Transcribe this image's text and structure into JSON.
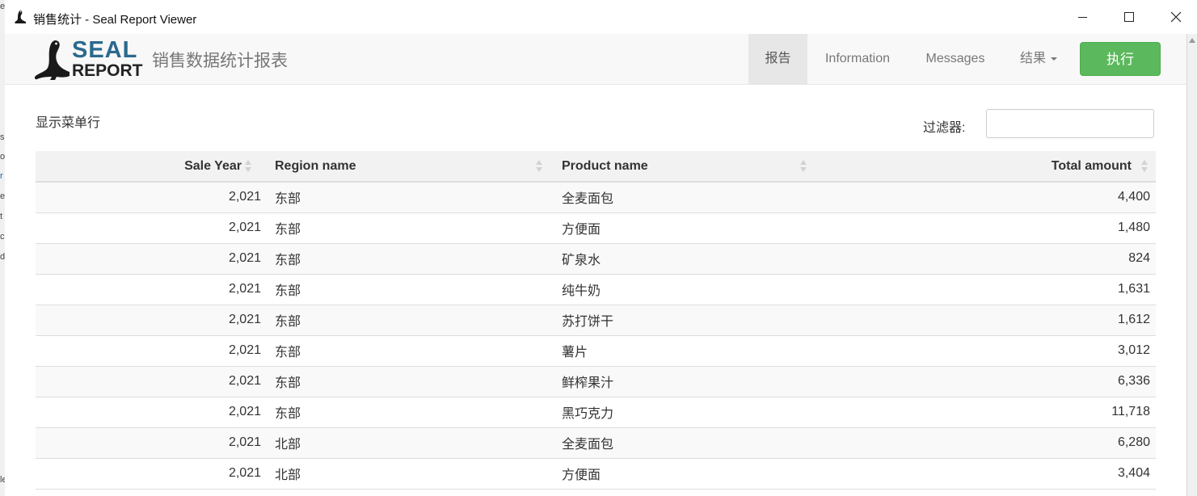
{
  "window": {
    "title": "销售统计 - Seal Report Viewer"
  },
  "desktop": {
    "left_fragments": [
      "e",
      "si",
      "o",
      "r",
      "e\t",
      "t",
      "c",
      "d",
      "le"
    ]
  },
  "navbar": {
    "logo_top": "SEAL",
    "logo_bottom": "REPORT",
    "brand_title": "销售数据统计报表",
    "items": [
      {
        "label": "报告",
        "active": true
      },
      {
        "label": "Information",
        "active": false
      },
      {
        "label": "Messages",
        "active": false
      },
      {
        "label": "结果",
        "active": false,
        "dropdown": true
      }
    ],
    "execute_label": "执行"
  },
  "toolbar": {
    "show_menu_label": "显示菜单行",
    "filter_label": "过滤器:",
    "filter_value": ""
  },
  "table": {
    "columns": [
      "Sale Year",
      "Region name",
      "Product name",
      "Total amount"
    ],
    "rows": [
      [
        "2,021",
        "东部",
        "全麦面包",
        "4,400"
      ],
      [
        "2,021",
        "东部",
        "方便面",
        "1,480"
      ],
      [
        "2,021",
        "东部",
        "矿泉水",
        "824"
      ],
      [
        "2,021",
        "东部",
        "纯牛奶",
        "1,631"
      ],
      [
        "2,021",
        "东部",
        "苏打饼干",
        "1,612"
      ],
      [
        "2,021",
        "东部",
        "薯片",
        "3,012"
      ],
      [
        "2,021",
        "东部",
        "鲜榨果汁",
        "6,336"
      ],
      [
        "2,021",
        "东部",
        "黑巧克力",
        "11,718"
      ],
      [
        "2,021",
        "北部",
        "全麦面包",
        "6,280"
      ],
      [
        "2,021",
        "北部",
        "方便面",
        "3,404"
      ]
    ]
  },
  "colors": {
    "execute_button": "#5cb85c",
    "logo_blue": "#2a6a8e",
    "navbar_bg": "#f8f8f8",
    "active_tab_bg": "#e7e7e7"
  }
}
